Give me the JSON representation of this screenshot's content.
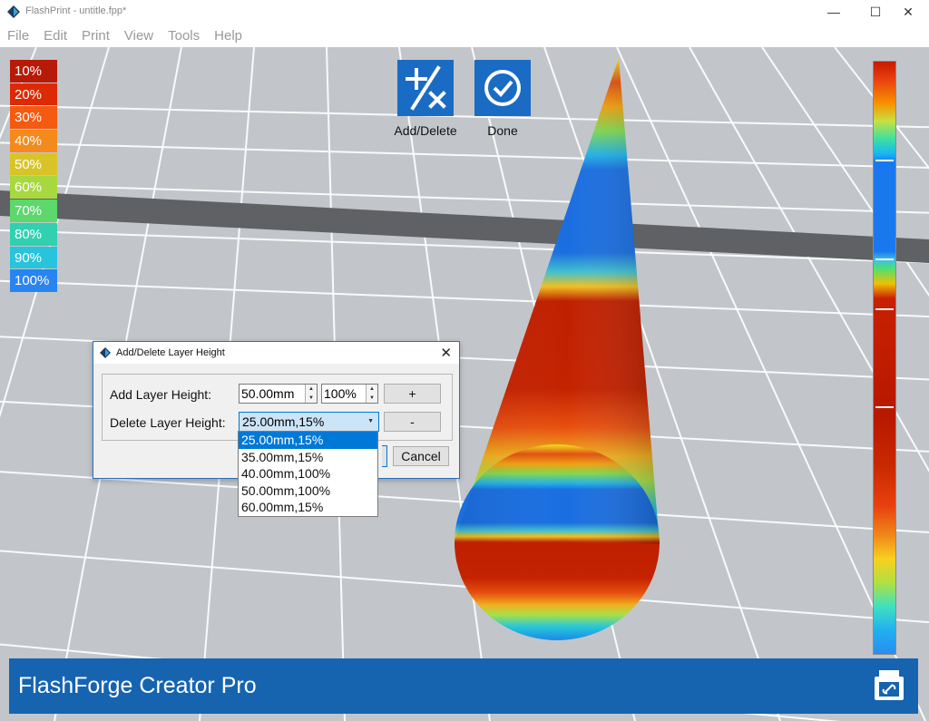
{
  "window": {
    "title": "FlashPrint - untitle.fpp*"
  },
  "menu": [
    "File",
    "Edit",
    "Print",
    "View",
    "Tools",
    "Help"
  ],
  "legend": [
    {
      "label": "10%",
      "color": "#b81a08"
    },
    {
      "label": "20%",
      "color": "#dc2a04"
    },
    {
      "label": "30%",
      "color": "#f45a10"
    },
    {
      "label": "40%",
      "color": "#f48a1c"
    },
    {
      "label": "50%",
      "color": "#d8c428"
    },
    {
      "label": "60%",
      "color": "#a8d840"
    },
    {
      "label": "70%",
      "color": "#5cd86c"
    },
    {
      "label": "80%",
      "color": "#30d0b0"
    },
    {
      "label": "90%",
      "color": "#28c4dc"
    },
    {
      "label": "100%",
      "color": "#2a84f0"
    }
  ],
  "toolbar": {
    "add_delete_label": "Add/Delete",
    "done_label": "Done"
  },
  "footer": {
    "printer_name": "FlashForge Creator Pro"
  },
  "dialog": {
    "title": "Add/Delete Layer Height",
    "add_label": "Add Layer Height:",
    "add_height_value": "50.00mm",
    "add_percent_value": "100%",
    "add_button": "+",
    "delete_label": "Delete Layer Height:",
    "delete_selected": "25.00mm,15%",
    "delete_button": "-",
    "cancel_button": "Cancel",
    "options": [
      "25.00mm,15%",
      "35.00mm,15%",
      "40.00mm,100%",
      "50.00mm,100%",
      "60.00mm,15%"
    ]
  },
  "colors": {
    "accent": "#1664b0",
    "selection": "#0078d7"
  }
}
